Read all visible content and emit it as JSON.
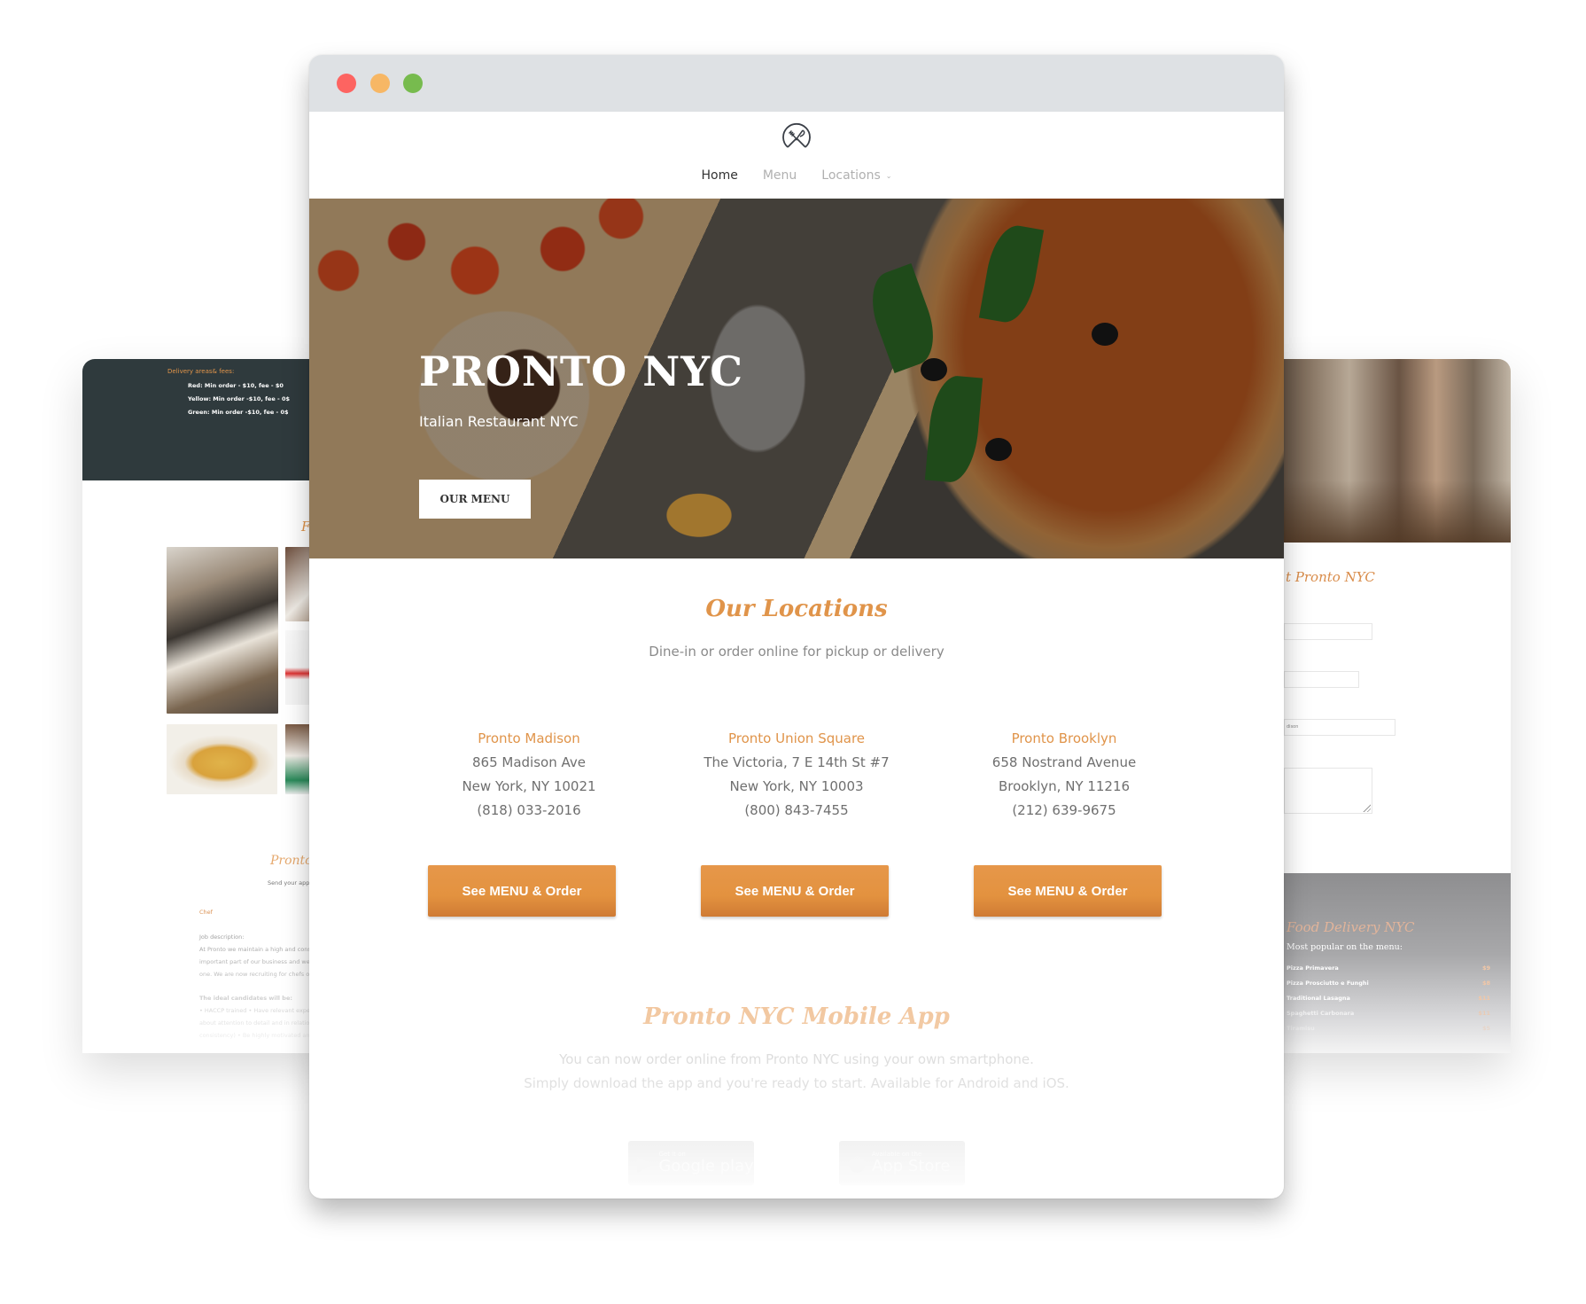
{
  "left_panel": {
    "delivery_title": "Delivery areas& fees:",
    "delivery_rows": [
      "Red: Min order - $10, fee - $0",
      "Yellow: Min order -$10, fee - 0$",
      "Green: Min order -$10, fee - 0$"
    ],
    "gallery_heading": "F",
    "careers_heading": "Pronto",
    "careers_sub": "Send your appl",
    "job_title": "Chef",
    "job_lines": [
      "Job description:",
      "At Pronto we maintain a high and cons",
      "important part of our business and we",
      "one. We are now recruiting for chefs o",
      "The ideal candidates will be:",
      "• HACCP trained • Have relevant experi",
      "about attention to detail and in relatio",
      "consistency) • Be highly motivated and"
    ]
  },
  "right_panel": {
    "heading": "t Pronto NYC",
    "form_field_value": "dison",
    "delivery_title": "Food Delivery NYC",
    "delivery_sub": "Most popular on the menu:",
    "menu_items": [
      {
        "name": "Pizza Primavera",
        "price": "$9"
      },
      {
        "name": "Pizza Prosciutto e Funghi",
        "price": "$8"
      },
      {
        "name": "Traditional Lasagna",
        "price": "$11"
      },
      {
        "name": "Spaghetti Carbonara",
        "price": "$11"
      },
      {
        "name": "Tiramisu",
        "price": "$5"
      }
    ]
  },
  "window": {
    "controls": [
      "close",
      "minimize",
      "maximize"
    ],
    "colors": {
      "close": "#fd6461",
      "minimize": "#f7b765",
      "maximize": "#77bb4e",
      "accent": "#e0944a"
    }
  },
  "nav": {
    "logo": "fork-knife-logo-icon",
    "items": [
      {
        "label": "Home",
        "active": true
      },
      {
        "label": "Menu",
        "active": false
      },
      {
        "label": "Locations",
        "active": false,
        "dropdown": true
      }
    ]
  },
  "hero": {
    "title": "PRONTO NYC",
    "subtitle": "Italian Restaurant NYC",
    "button": "OUR MENU"
  },
  "locations": {
    "title": "Our Locations",
    "subtitle": "Dine-in or order online for pickup or delivery",
    "items": [
      {
        "name": "Pronto Madison",
        "address": "865 Madison Ave",
        "city": "New York, NY 10021",
        "phone": "(818) 033-2016",
        "button": "See MENU & Order"
      },
      {
        "name": "Pronto Union Square",
        "address": "The Victoria, 7 E 14th St #7",
        "city": "New York, NY 10003",
        "phone": "(800) 843-7455",
        "button": "See MENU & Order"
      },
      {
        "name": "Pronto Brooklyn",
        "address": "658 Nostrand Avenue",
        "city": "Brooklyn, NY 11216",
        "phone": "(212) 639-9675",
        "button": "See MENU & Order"
      }
    ]
  },
  "app": {
    "title": "Pronto NYC Mobile App",
    "line1": "You can now order online from Pronto NYC using your own smartphone.",
    "line2": "Simply download the app and you're ready to start. Available for Android and iOS.",
    "google": {
      "small": "Get it on",
      "big": "Google play"
    },
    "apple": {
      "small": "Available on the",
      "big": "App Store"
    }
  }
}
